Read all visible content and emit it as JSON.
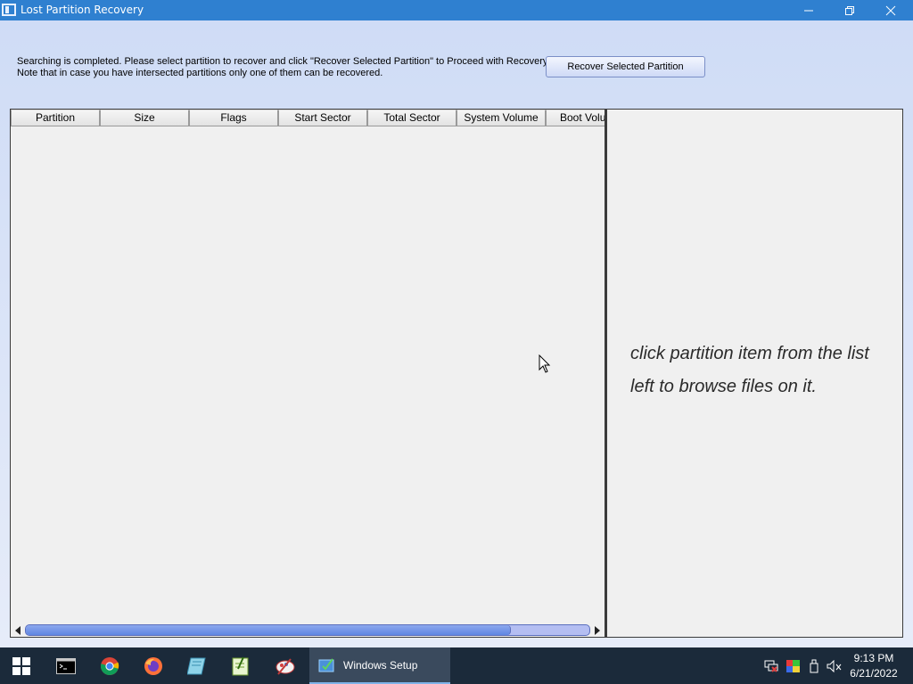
{
  "window": {
    "title": "Lost Partition Recovery",
    "controls": [
      "minimize-icon",
      "restore-icon",
      "close-icon"
    ]
  },
  "info": {
    "line1": "Searching is completed. Please select partition to recover and click \"Recover Selected Partition\" to Proceed with Recovery.",
    "line2": "Note that in case you have intersected partitions only one of them can be recovered."
  },
  "recover_button": {
    "label": "Recover Selected Partition"
  },
  "partition_list": {
    "columns": [
      "Partition",
      "Size",
      "Flags",
      "Start Sector",
      "Total Sector",
      "System Volume",
      "Boot Volu"
    ],
    "rows": [],
    "scrollbar": {
      "position_fraction": 0.0,
      "visible_fraction": 0.86
    }
  },
  "files_pane": {
    "hint": "click partition item from the list left to browse files on it."
  },
  "taskbar": {
    "pinned": [
      "windows-start-icon",
      "command-prompt-icon",
      "chrome-icon",
      "firefox-icon",
      "notepad-icon",
      "editor-icon",
      "paint-icon"
    ],
    "active_task": {
      "label": "Windows Setup",
      "icon": "windows-setup-icon"
    },
    "tray": [
      "network-icon",
      "color-icon",
      "usb-icon",
      "volume-muted-icon"
    ],
    "clock": {
      "time": "9:13 PM",
      "date": "6/21/2022"
    }
  },
  "colors": {
    "titlebar": "#2f80d0",
    "client_bg": "#d9e3f7",
    "scroll_thumb": "#6f93e8",
    "taskbar": "#1b2a3a"
  }
}
